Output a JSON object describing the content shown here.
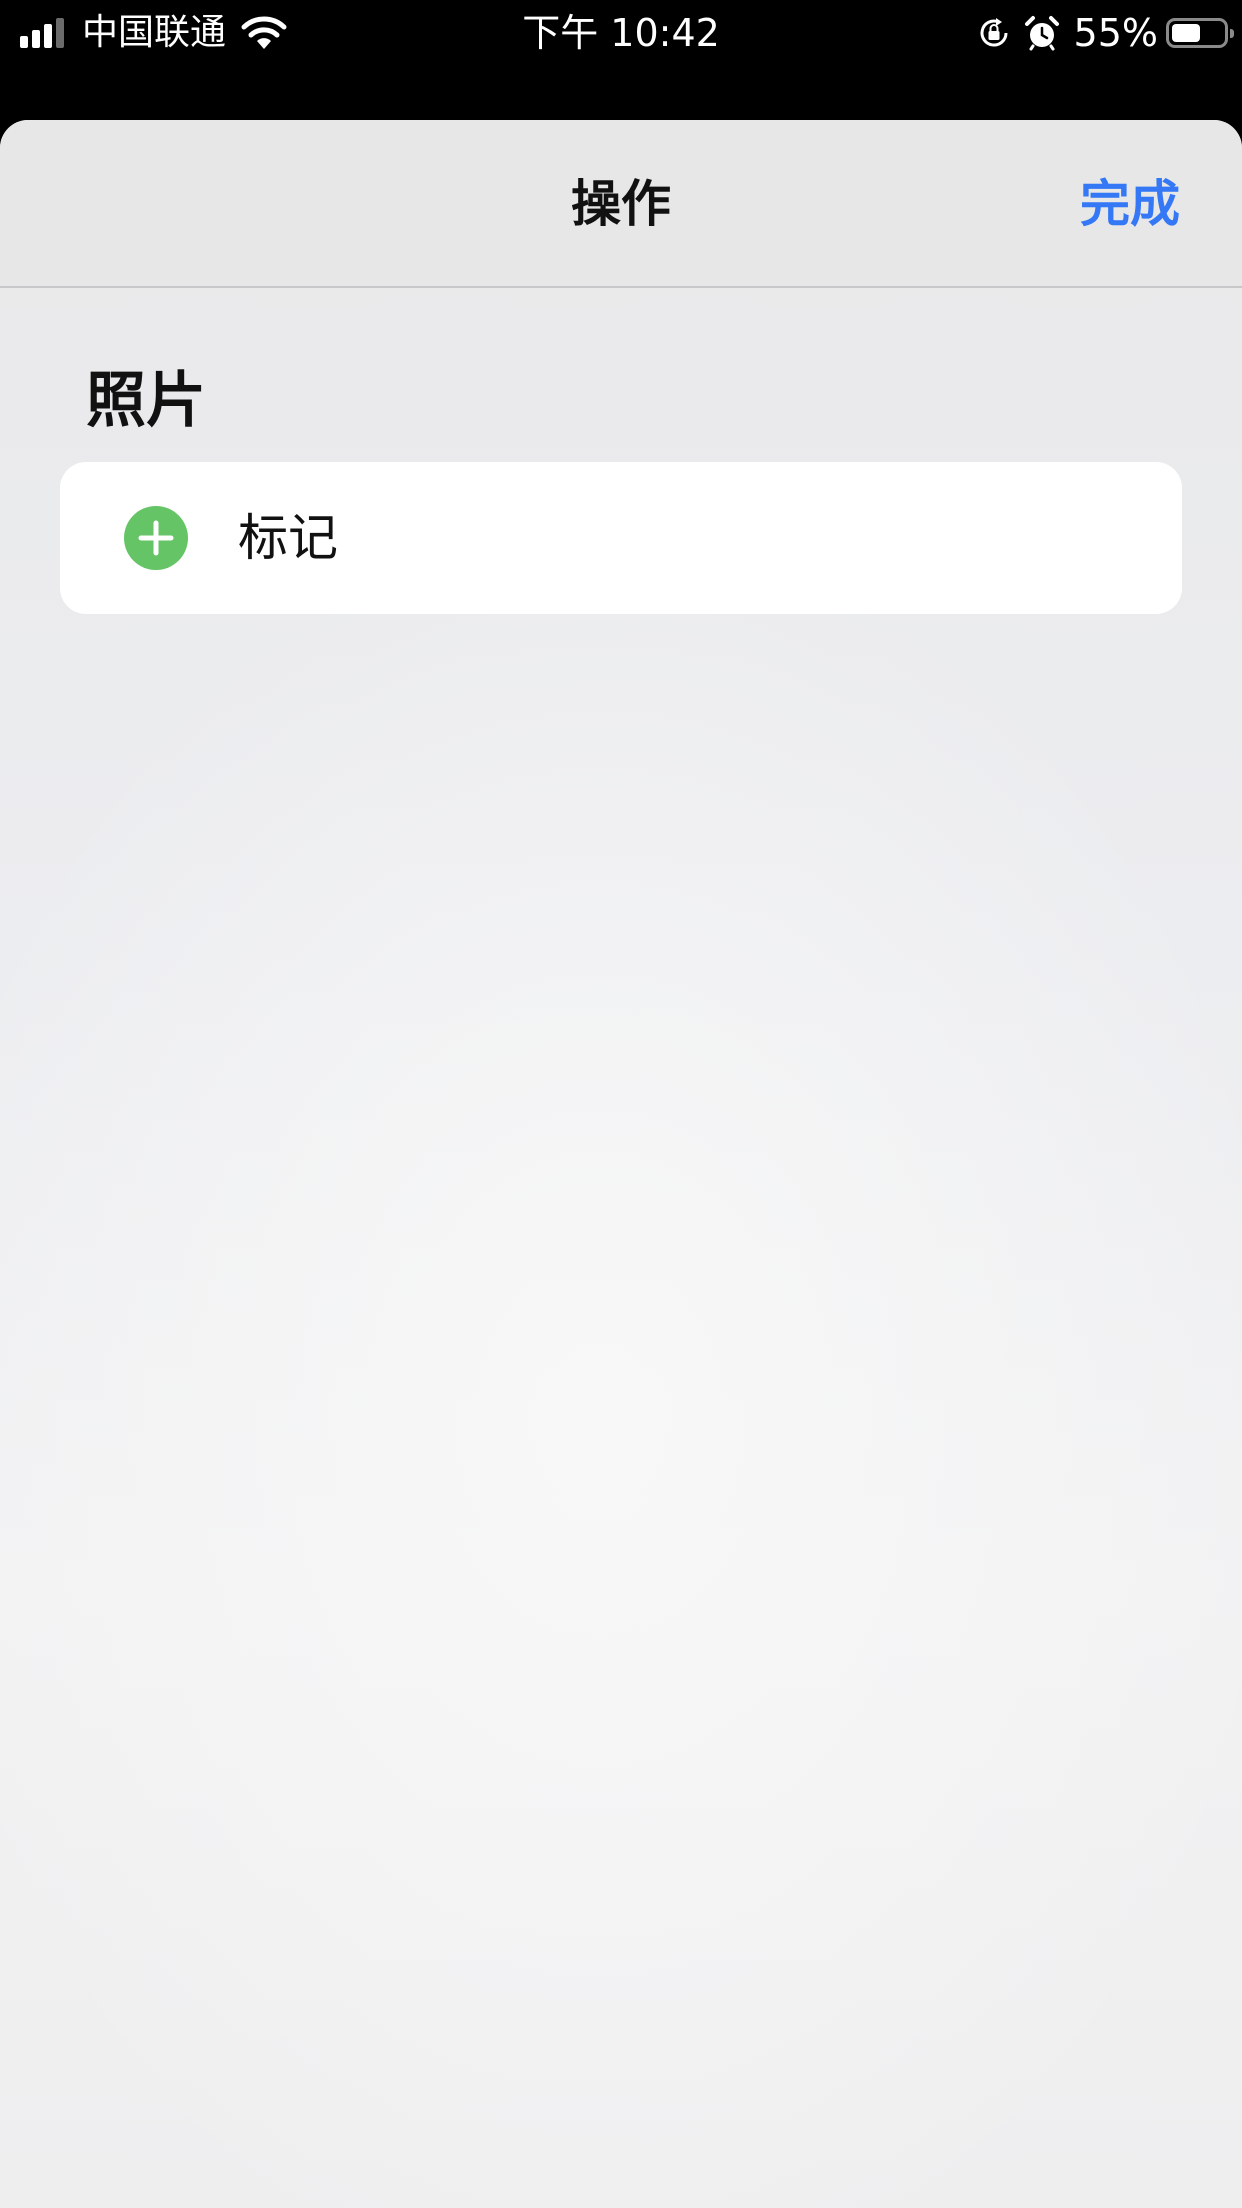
{
  "status_bar": {
    "carrier": "中国联通",
    "time": "下午 10:42",
    "battery_percent": "55%",
    "battery_level": 0.55,
    "icons": [
      "signal-icon",
      "wifi-icon",
      "rotation-lock-icon",
      "alarm-icon",
      "battery-icon"
    ]
  },
  "nav": {
    "title": "操作",
    "done_label": "完成"
  },
  "sections": [
    {
      "header": "照片",
      "items": [
        {
          "label": "标记",
          "icon": "add-icon",
          "icon_color": "#65c466"
        }
      ]
    }
  ],
  "colors": {
    "accent": "#3478f6",
    "add_green": "#65c466"
  }
}
